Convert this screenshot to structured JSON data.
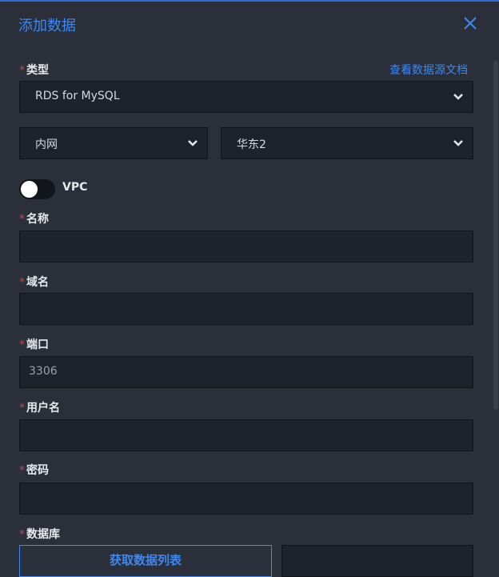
{
  "dialog": {
    "title": "添加数据",
    "close_icon": "close-icon",
    "accent_color": "#3d88f2",
    "required_color": "#e23b3b"
  },
  "type_field": {
    "label": "类型",
    "required_mark": "*",
    "doc_link": "查看数据源文档",
    "value": "RDS for MySQL"
  },
  "network_select": {
    "value": "内网"
  },
  "region_select": {
    "value": "华东2"
  },
  "vpc_toggle": {
    "label": "VPC",
    "enabled": false
  },
  "name_field": {
    "label": "名称",
    "required_mark": "*",
    "value": ""
  },
  "domain_field": {
    "label": "域名",
    "required_mark": "*",
    "value": ""
  },
  "port_field": {
    "label": "端口",
    "required_mark": "*",
    "value": "3306"
  },
  "username_field": {
    "label": "用户名",
    "required_mark": "*",
    "value": ""
  },
  "password_field": {
    "label": "密码",
    "required_mark": "*",
    "value": ""
  },
  "database_field": {
    "label": "数据库",
    "required_mark": "*",
    "fetch_button": "获取数据列表"
  }
}
